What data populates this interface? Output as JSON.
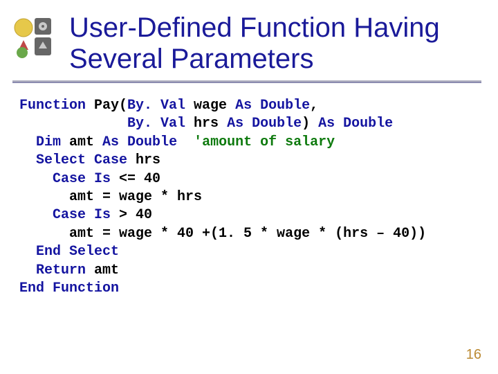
{
  "title": "User-Defined Function Having Several Parameters",
  "page_number": "16",
  "code": {
    "l1a": "Function",
    "l1b": " Pay(",
    "l1c": "By. Val",
    "l1d": " wage ",
    "l1e": "As Double",
    "l1f": ",",
    "l2a": "             ",
    "l2b": "By. Val",
    "l2c": " hrs ",
    "l2d": "As Double",
    "l2e": ") ",
    "l2f": "As Double",
    "l3a": "  ",
    "l3b": "Dim",
    "l3c": " amt ",
    "l3d": "As Double",
    "l3e": "  ",
    "l3f": "'amount of salary",
    "l4a": "  ",
    "l4b": "Select Case",
    "l4c": " hrs",
    "l5a": "    ",
    "l5b": "Case Is",
    "l5c": " <= 40",
    "l6a": "      amt = wage * hrs",
    "l7a": "    ",
    "l7b": "Case Is",
    "l7c": " > 40",
    "l8a": "      amt = wage * 40 +(1. 5 * wage * (hrs – 40))",
    "l9a": "  ",
    "l9b": "End Select",
    "l10a": "  ",
    "l10b": "Return",
    "l10c": " amt",
    "l11a": "End Function"
  },
  "logo": {
    "colors": {
      "yellow": "#e6c84a",
      "red": "#c04848",
      "blue": "#4a6aa8",
      "green": "#6aa84a",
      "gray": "#666666"
    }
  }
}
